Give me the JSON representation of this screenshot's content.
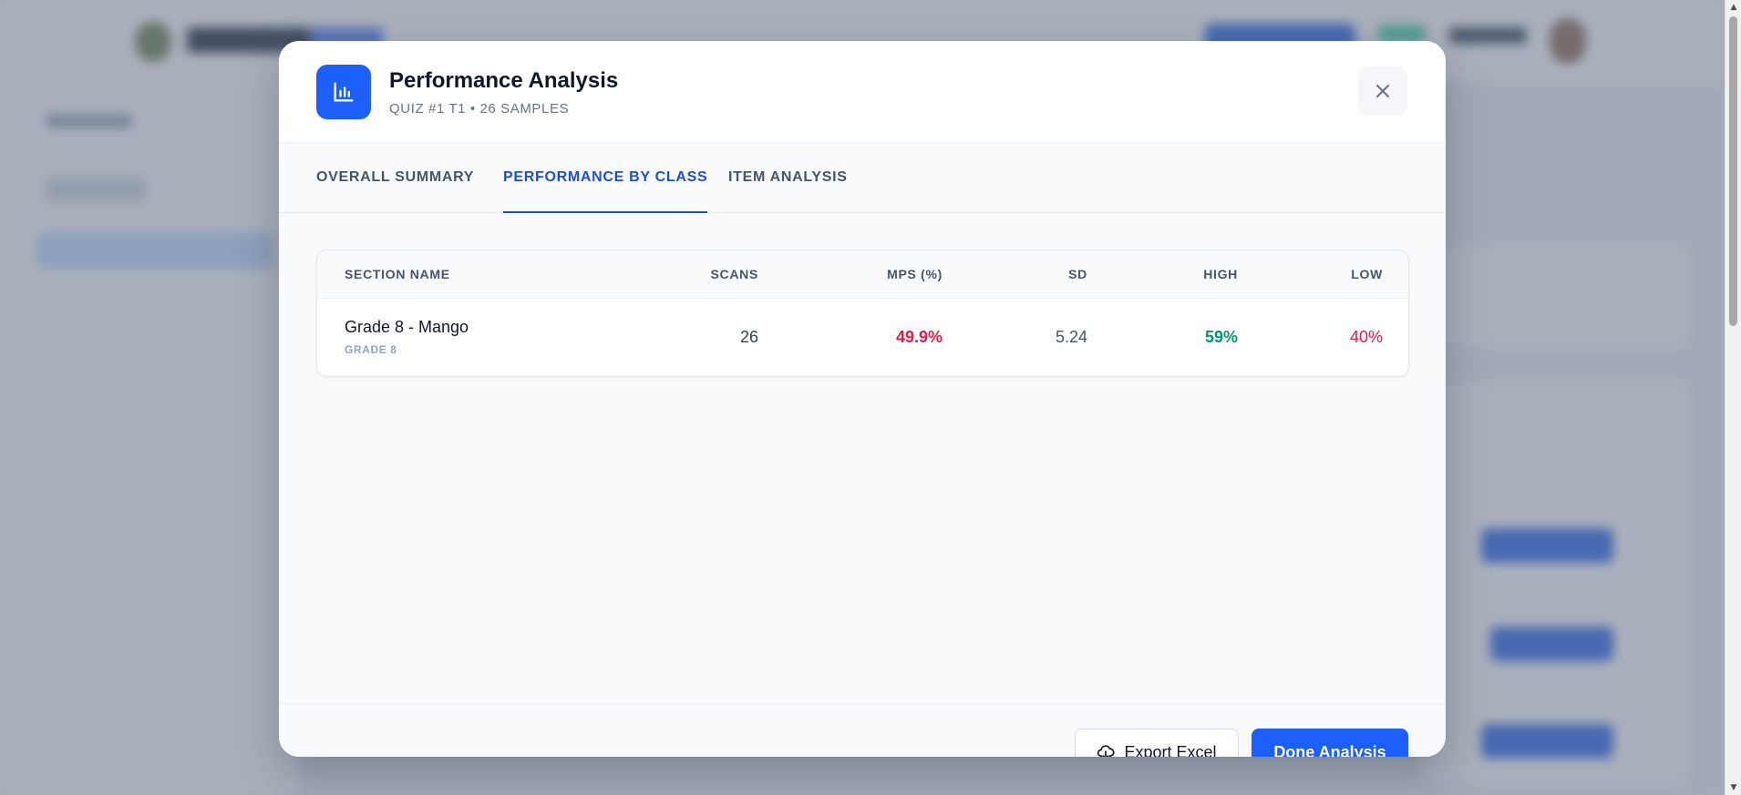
{
  "modal": {
    "title": "Performance Analysis",
    "subtitle": "QUIZ #1 T1 • 26 SAMPLES",
    "icon": "bar-chart-icon",
    "close_icon": "close-icon"
  },
  "tabs": [
    {
      "label": "OVERALL SUMMARY",
      "active": false
    },
    {
      "label": "PERFORMANCE BY CLASS",
      "active": true
    },
    {
      "label": "ITEM ANALYSIS",
      "active": false
    }
  ],
  "table": {
    "headers": [
      "SECTION NAME",
      "SCANS",
      "MPS (%)",
      "SD",
      "HIGH",
      "LOW"
    ],
    "rows": [
      {
        "section_name": "Grade 8 - Mango",
        "grade": "GRADE 8",
        "scans": "26",
        "mps": "49.9%",
        "sd": "5.24",
        "high": "59%",
        "low": "40%"
      }
    ]
  },
  "footer": {
    "export_label": "Export Excel",
    "export_icon": "cloud-download-icon",
    "done_label": "Done Analysis"
  },
  "colors": {
    "accent": "#1d5ffb",
    "negative": "#e11d48",
    "positive": "#059669"
  }
}
